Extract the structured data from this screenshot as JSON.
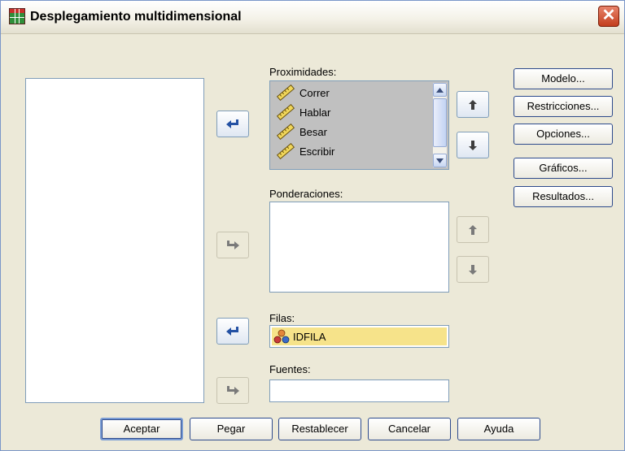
{
  "window": {
    "title": "Desplegamiento multidimensional",
    "close_glyph": "✕"
  },
  "fields": {
    "proximidades": {
      "label": "Proximidades:",
      "items": [
        {
          "label": "Correr",
          "icon": "ruler-icon"
        },
        {
          "label": "Hablar",
          "icon": "ruler-icon"
        },
        {
          "label": "Besar",
          "icon": "ruler-icon"
        },
        {
          "label": "Escribir",
          "icon": "ruler-icon"
        }
      ]
    },
    "ponderaciones": {
      "label": "Ponderaciones:"
    },
    "filas": {
      "label": "Filas:",
      "value": "IDFILA",
      "icon": "nominal-variable-icon",
      "highlight_color": "#f6e38a"
    },
    "fuentes": {
      "label": "Fuentes:"
    }
  },
  "side_buttons": [
    "Modelo...",
    "Restricciones...",
    "Opciones...",
    "Gráficos...",
    "Resultados..."
  ],
  "bottom_buttons": [
    "Aceptar",
    "Pegar",
    "Restablecer",
    "Cancelar",
    "Ayuda"
  ],
  "colors": {
    "accent_arrow": "#2451a3",
    "disabled_arrow": "#7a7a7a",
    "dialog_bg": "#ece9d8"
  }
}
